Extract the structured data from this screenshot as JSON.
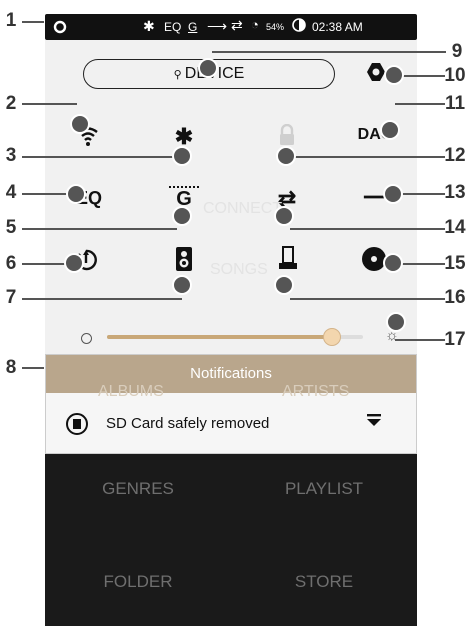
{
  "status_bar": {
    "bluetooth_icon": "bluetooth-icon",
    "eq_label": "EQ",
    "gain_label": "G",
    "battery_percent": "54%",
    "time": "02:38 AM"
  },
  "panel": {
    "device_button_label": "DEVICE",
    "ghost_labels": [
      "CONNECT",
      "SONGS"
    ]
  },
  "callouts": [
    "1",
    "2",
    "3",
    "4",
    "5",
    "6",
    "7",
    "8",
    "9",
    "10",
    "11",
    "12",
    "13",
    "14",
    "15",
    "16",
    "17"
  ],
  "quick_settings": {
    "eq_label": "EQ",
    "gain_label": "G",
    "dac_label": "DAC"
  },
  "volume": {
    "level": 0.88
  },
  "notification": {
    "title": "Notifications",
    "message": "SD Card safely removed",
    "ghost_tabs": [
      "ALBUMS",
      "ARTISTS"
    ]
  },
  "library": {
    "items": [
      "GENRES",
      "PLAYLIST",
      "FOLDER",
      "STORE"
    ]
  },
  "colors": {
    "accent": "#b9a68c",
    "callout": "#555555",
    "library_bg": "#1a1a1a"
  }
}
